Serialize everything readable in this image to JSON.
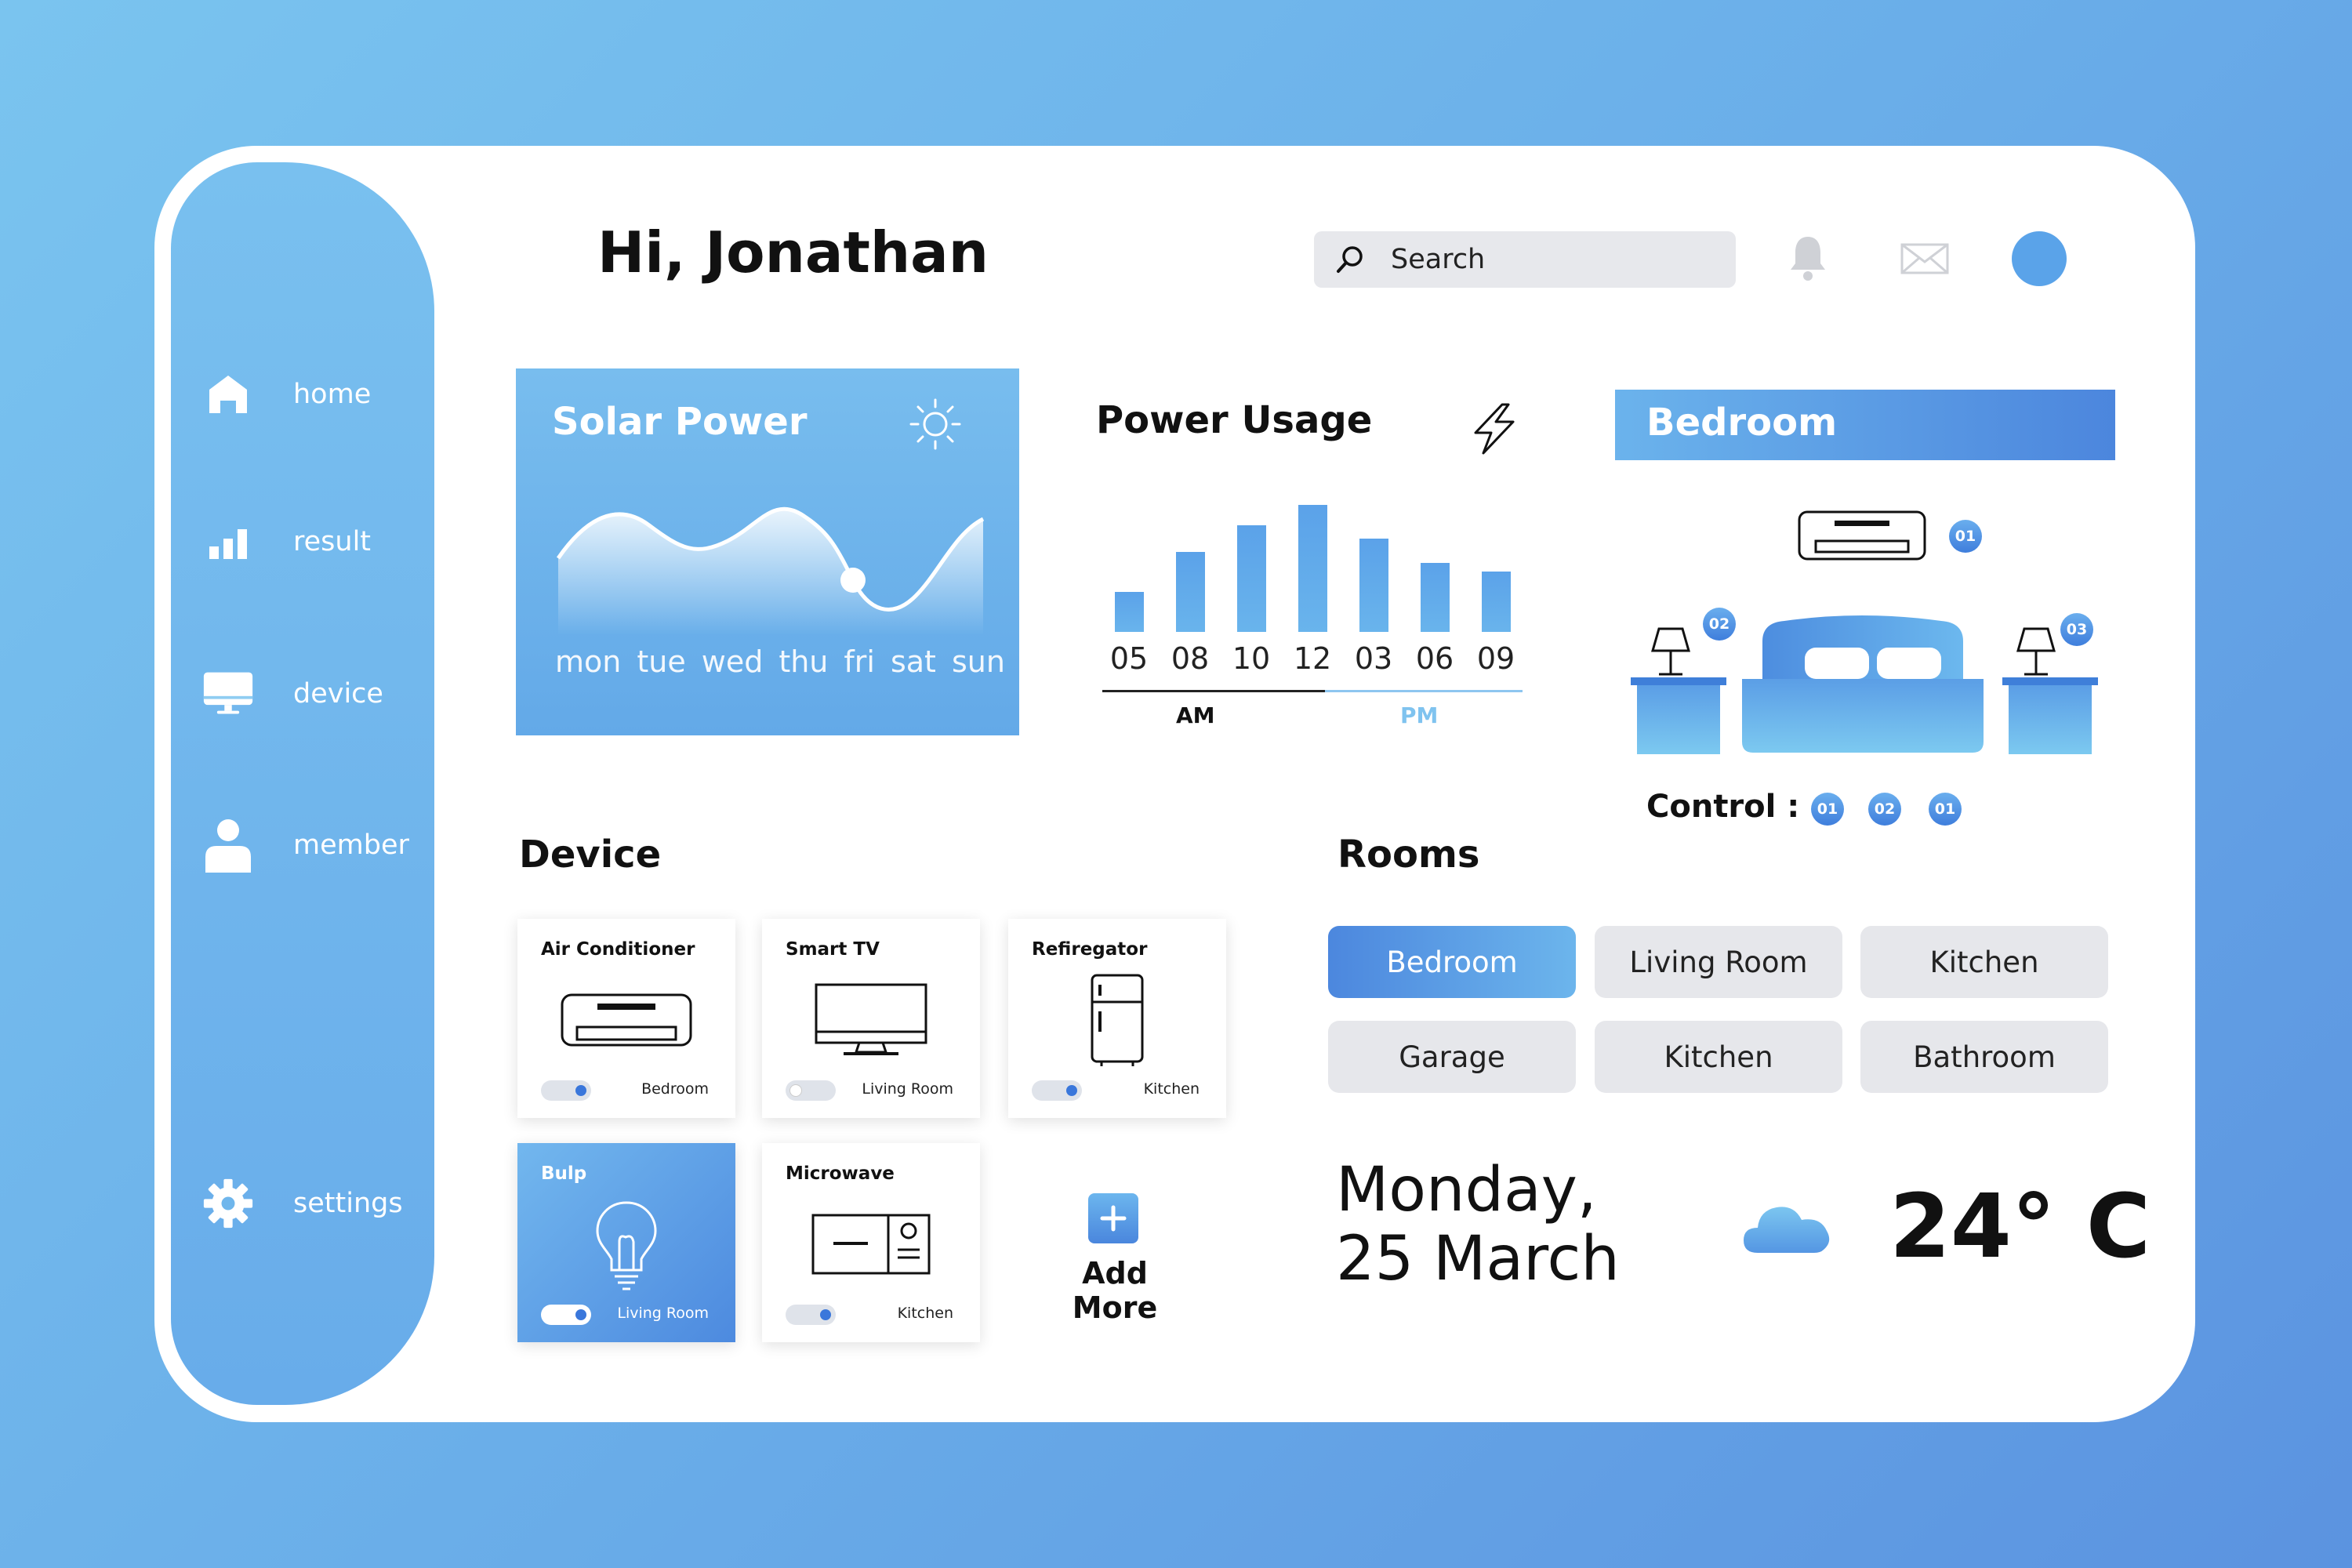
{
  "header": {
    "greeting": "Hi, Jonathan",
    "search_placeholder": "Search"
  },
  "sidebar": {
    "items": [
      {
        "label": "home",
        "icon": "home-icon"
      },
      {
        "label": "result",
        "icon": "bar-chart-icon"
      },
      {
        "label": "device",
        "icon": "monitor-icon"
      },
      {
        "label": "member",
        "icon": "user-icon"
      },
      {
        "label": "settings",
        "icon": "gear-icon"
      }
    ]
  },
  "solar": {
    "title": "Solar Power",
    "days": [
      "mon",
      "tue",
      "wed",
      "thu",
      "fri",
      "sat",
      "sun"
    ]
  },
  "power_usage": {
    "title": "Power Usage",
    "am_label": "AM",
    "pm_label": "PM"
  },
  "chart_data": {
    "type": "bar",
    "title": "Power Usage",
    "categories": [
      "05",
      "08",
      "10",
      "12",
      "03",
      "06",
      "09"
    ],
    "values": [
      30,
      60,
      80,
      95,
      70,
      52,
      45
    ],
    "ylim": [
      0,
      100
    ],
    "grid": false
  },
  "bedroom": {
    "title": "Bedroom",
    "badges": {
      "ac": "01",
      "lamp_left": "02",
      "lamp_right": "03"
    },
    "control_label": "Control :",
    "controls": [
      "01",
      "02",
      "01"
    ]
  },
  "devices": {
    "title": "Device",
    "items": [
      {
        "name": "Air Conditioner",
        "room": "Bedroom",
        "on": true
      },
      {
        "name": "Smart TV",
        "room": "Living Room",
        "on": false
      },
      {
        "name": "Refiregator",
        "room": "Kitchen",
        "on": true
      },
      {
        "name": "Bulp",
        "room": "Living Room",
        "on": true
      },
      {
        "name": "Microwave",
        "room": "Kitchen",
        "on": true
      }
    ],
    "add_more": "Add More"
  },
  "rooms": {
    "title": "Rooms",
    "items": [
      "Bedroom",
      "Living Room",
      "Kitchen",
      "Garage",
      "Kitchen",
      "Bathroom"
    ],
    "selected": "Bedroom"
  },
  "weather": {
    "date_line1": "Monday,",
    "date_line2": "25 March",
    "temperature": "24° C"
  },
  "colors": {
    "accent": "#5aa3e9",
    "accent_dark": "#4c86dd",
    "sidebar": "#72b7ee",
    "background": "#6aaee9"
  }
}
